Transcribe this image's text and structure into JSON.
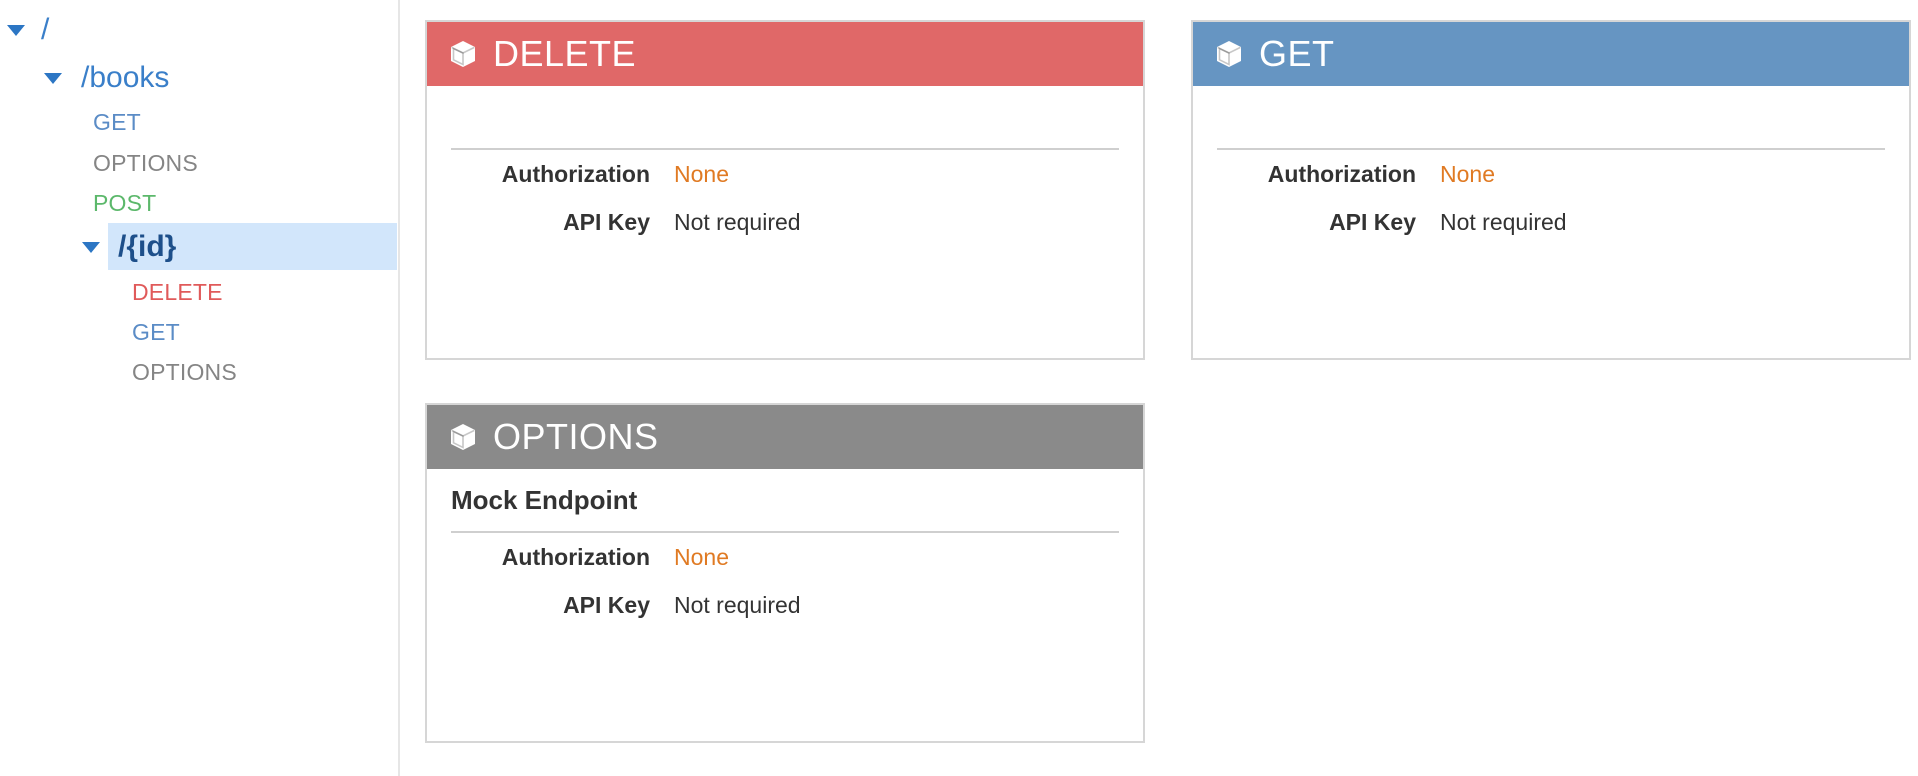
{
  "sidebar": {
    "root": {
      "label": "/"
    },
    "books": {
      "label": "/books",
      "methods": [
        {
          "label": "GET",
          "method": "get"
        },
        {
          "label": "OPTIONS",
          "method": "options"
        },
        {
          "label": "POST",
          "method": "post"
        }
      ]
    },
    "id_resource": {
      "label": "/{id}",
      "selected": true,
      "methods": [
        {
          "label": "DELETE",
          "method": "delete"
        },
        {
          "label": "GET",
          "method": "get"
        },
        {
          "label": "OPTIONS",
          "method": "options"
        }
      ]
    }
  },
  "cards": {
    "delete": {
      "title": "DELETE",
      "subtitle": "",
      "authorization_label": "Authorization",
      "authorization_value": "None",
      "api_key_label": "API Key",
      "api_key_value": "Not required"
    },
    "get": {
      "title": "GET",
      "subtitle": "",
      "authorization_label": "Authorization",
      "authorization_value": "None",
      "api_key_label": "API Key",
      "api_key_value": "Not required"
    },
    "options": {
      "title": "OPTIONS",
      "subtitle": "Mock Endpoint",
      "authorization_label": "Authorization",
      "authorization_value": "None",
      "api_key_label": "API Key",
      "api_key_value": "Not required"
    }
  },
  "icons": {
    "caret": "caret-down-icon",
    "method_card": "cube-icon"
  },
  "colors": {
    "delete_header": "#e06868",
    "get_header": "#6695c2",
    "options_header": "#8a8a8a",
    "selected_row": "#d2e6fb",
    "link_blue": "#3a7fc9",
    "post_green": "#5cb86b",
    "authorization_value": "#e07a23"
  }
}
